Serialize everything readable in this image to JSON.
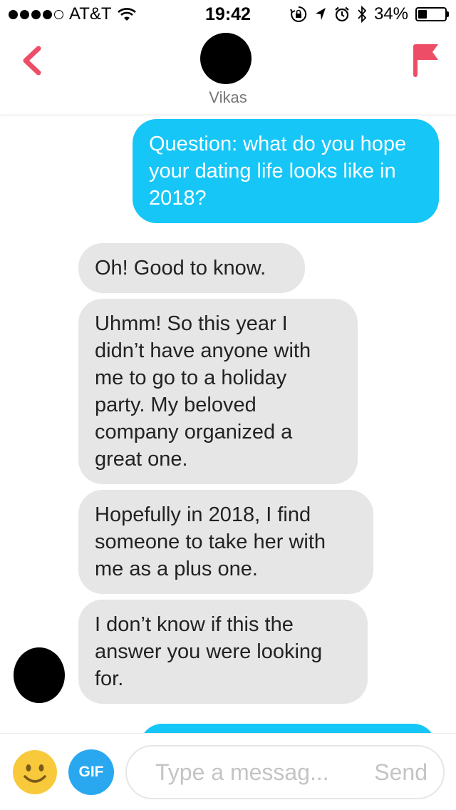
{
  "status_bar": {
    "carrier": "AT&T",
    "time": "19:42",
    "battery_percent": "34%",
    "battery_level": 0.34,
    "icons": [
      "signal-dots-icon",
      "wifi-icon",
      "rotation-lock-icon",
      "location-icon",
      "alarm-icon",
      "bluetooth-icon",
      "battery-icon"
    ]
  },
  "header": {
    "contact_name": "Vikas",
    "back_icon": "chevron-left-icon",
    "flag_icon": "flag-icon",
    "accent_color": "#ee4d67"
  },
  "messages": [
    {
      "direction": "outgoing",
      "text": "Question: what do you hope your dating life looks like in 2018?"
    },
    {
      "direction": "incoming",
      "text": "Oh! Good to know."
    },
    {
      "direction": "incoming",
      "text": "Uhmm! So this year I didn’t have anyone with me to go to a holiday party. My beloved company organized a great one."
    },
    {
      "direction": "incoming",
      "text": "Hopefully in 2018, I find someone to take her with me as a plus one."
    },
    {
      "direction": "incoming",
      "text": "I don’t know if this the answer you were looking for."
    }
  ],
  "input_bar": {
    "emoji_icon": "smiley-face-icon",
    "gif_label": "GIF",
    "placeholder": "Type a messag...",
    "send_label": "Send"
  },
  "colors": {
    "outgoing_bubble": "#16c6f7",
    "incoming_bubble": "#e6e6e6",
    "gif_button": "#29a8f0",
    "emoji": "#f8c93b"
  }
}
